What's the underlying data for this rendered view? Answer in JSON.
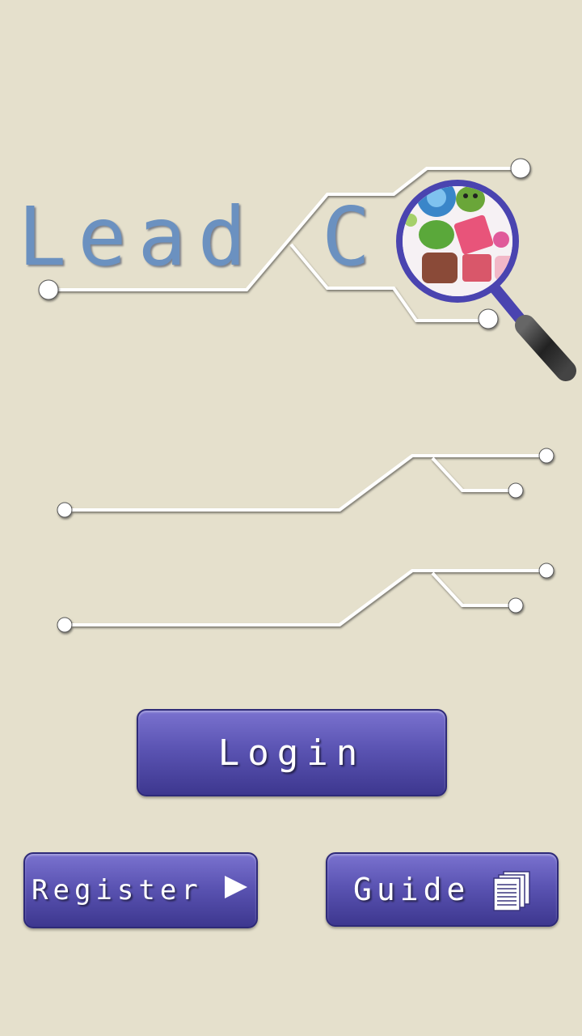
{
  "logo": {
    "text_lead": "Lead",
    "text_c": "C",
    "magnifier_icon": "magnifier-with-candy-icon"
  },
  "fields": {
    "username": {
      "value": "",
      "placeholder": ""
    },
    "password": {
      "value": "",
      "placeholder": ""
    }
  },
  "buttons": {
    "login_label": "Login",
    "register_label": "Register",
    "register_icon": "play-arrow-icon",
    "guide_label": "Guide",
    "guide_icon": "documents-icon"
  },
  "colors": {
    "background": "#e5e0cc",
    "logo_text": "#6b91c0",
    "button": "#5b54b3",
    "magnifier_ring": "#4a44b0"
  }
}
